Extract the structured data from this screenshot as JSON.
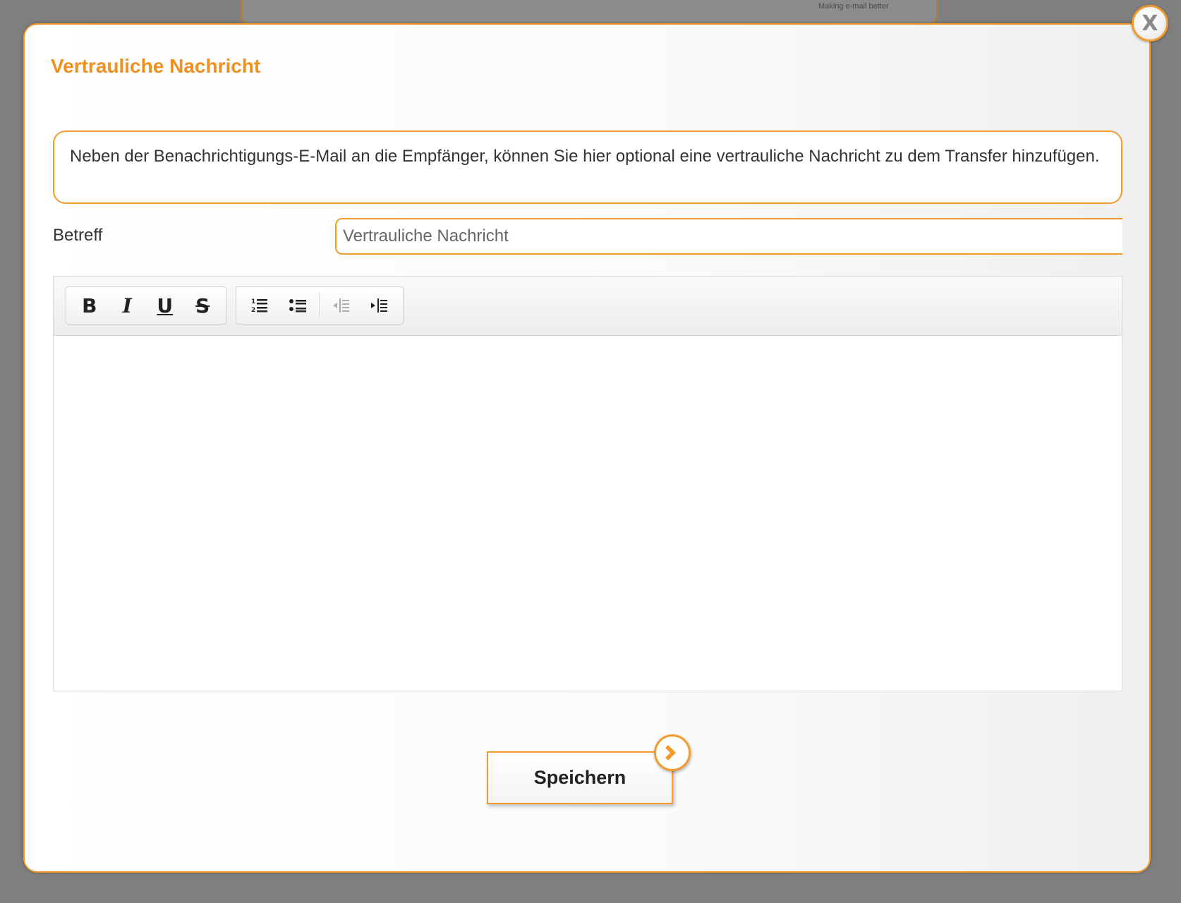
{
  "background": {
    "tagline": "Making e-mail better"
  },
  "dialog": {
    "title": "Vertrauliche Nachricht",
    "close_label": "X",
    "info_text": "Neben der Benachrichtigungs-E-Mail an die Empfänger, können Sie hier optional eine vertrauliche Nachricht zu dem Transfer hinzufügen.",
    "subject": {
      "label": "Betreff",
      "value": "Vertrauliche Nachricht"
    },
    "editor": {
      "toolbar": {
        "bold": "B",
        "italic": "I",
        "underline": "U",
        "strikethrough": "S",
        "icons": [
          "ordered-list-icon",
          "unordered-list-icon",
          "outdent-icon",
          "indent-icon"
        ]
      },
      "content": ""
    },
    "save_label": "Speichern"
  },
  "colors": {
    "accent": "#f39a2b",
    "title": "#f0901f",
    "overlay": "#7f7f7f"
  }
}
